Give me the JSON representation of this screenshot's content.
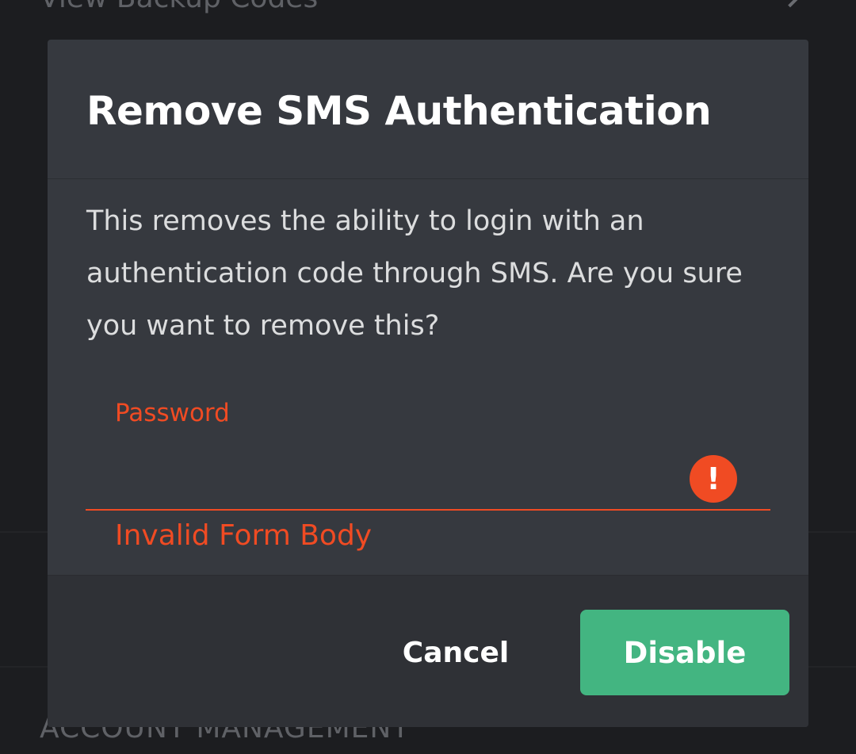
{
  "background": {
    "view_backup_codes": "View Backup Codes",
    "account_management": "ACCOUNT MANAGEMENT"
  },
  "modal": {
    "title": "Remove SMS Authentication",
    "description": "This removes the ability to login with an authentication code through SMS. Are you sure you want to remove this?",
    "password_label": "Password",
    "password_value": "",
    "error_icon": "!",
    "error_message": "Invalid Form Body",
    "cancel_label": "Cancel",
    "disable_label": "Disable"
  },
  "colors": {
    "modal_bg": "#36393f",
    "footer_bg": "#2f3136",
    "error": "#f04b23",
    "primary_green": "#43b581",
    "title_text": "#ffffff",
    "body_text": "#dcddde"
  },
  "icons": {
    "error_icon": "exclamation-circle-icon",
    "background_chevron": "chevron-right-icon"
  }
}
